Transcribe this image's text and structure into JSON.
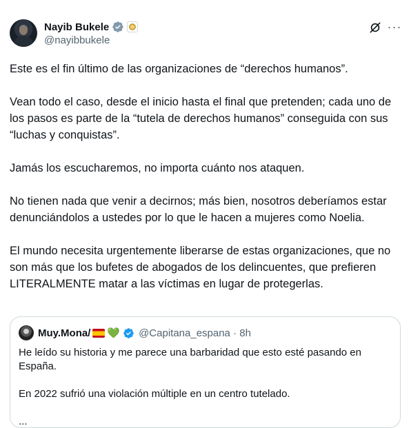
{
  "author": {
    "display_name": "Nayib Bukele",
    "handle": "@nayibbukele"
  },
  "post": {
    "paragraphs": [
      "Este es el fin último de las organizaciones de “derechos humanos”.",
      "Vean todo el caso, desde el inicio hasta el final que pretenden; cada uno de los pasos es parte de la “tutela de derechos humanos” conseguida con sus “luchas y conquistas”.",
      "Jamás los escucharemos, no importa cuánto nos ataquen.",
      "No tienen nada que venir a decirnos; más bien, nosotros deberíamos estar denunciándolos a ustedes por lo que le hacen a mujeres como Noelia.",
      "El mundo necesita urgentemente liberarse de estas organizaciones, que no son más que los bufetes de abogados de los delincuentes, que prefieren LITERALMENTE matar a las víctimas en lugar de protegerlas."
    ]
  },
  "quote": {
    "display_name": "Muy.Mona/",
    "heart": "💚",
    "handle_time": "@Capitana_espana · 8h",
    "paragraphs": [
      "He leído su historia y me parece una barbaridad que esto esté pasando en España.",
      "En 2022 sufrió una violación múltiple en un centro tutelado."
    ],
    "ellipsis": "..."
  },
  "icons": {
    "verified": "verified-badge-icon",
    "affiliate": "affiliate-badge-icon",
    "grok": "grok-icon",
    "more": "more-options-icon"
  },
  "colors": {
    "verified_blue": "#1d9bf0",
    "text": "#0f1419",
    "secondary": "#536471",
    "border": "#cfd9de"
  }
}
